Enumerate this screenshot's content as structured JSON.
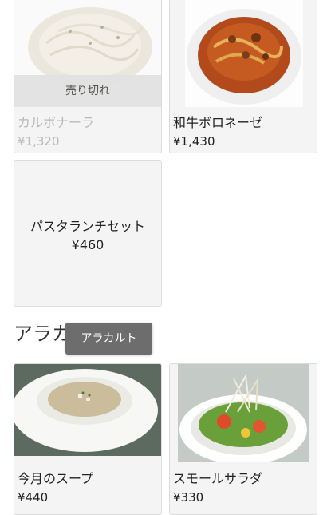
{
  "menu": {
    "items": [
      {
        "name": "カルボナーラ",
        "price": "¥1,320",
        "status": "売り切れ"
      },
      {
        "name": "和牛ボロネーゼ",
        "price": "¥1,430"
      },
      {
        "name": "パスタランチセット",
        "price": "¥460"
      }
    ]
  },
  "alacarte": {
    "title": "アラカルト",
    "tooltip": "アラカルト",
    "items": [
      {
        "name": "今月のスープ",
        "price": "¥440"
      },
      {
        "name": "スモールサラダ",
        "price": "¥330"
      }
    ]
  },
  "colors": {
    "card_bg": "#f4f4f4",
    "card_border": "#dcdcdc",
    "soldout_text": "#b9b9b9",
    "tooltip_bg": "#6d6d6d"
  }
}
